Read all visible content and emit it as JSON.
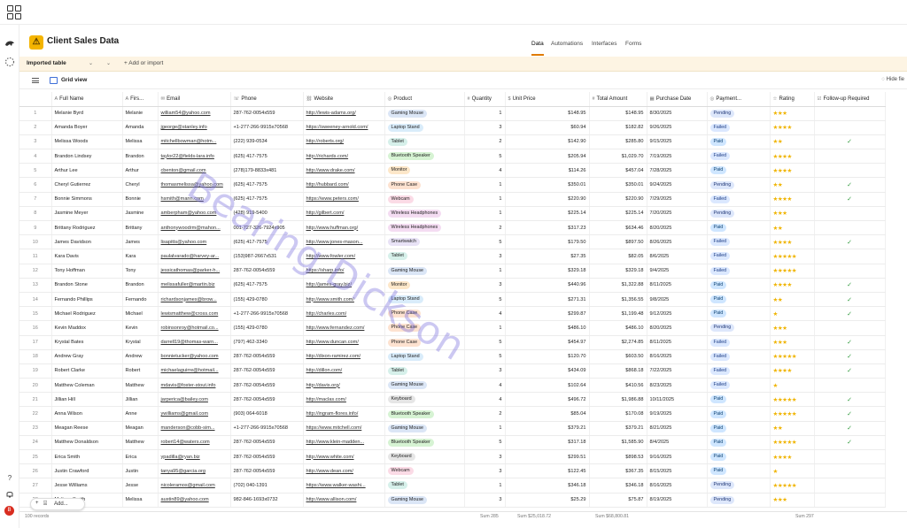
{
  "app": {
    "title": "Client Sales Data",
    "logo_color": "#f4b400"
  },
  "nav": {
    "tabs": [
      "Data",
      "Automations",
      "Interfaces",
      "Forms"
    ],
    "active": "Data"
  },
  "tablebar": {
    "table_name": "Imported table",
    "add_import": "Add or import"
  },
  "viewbar": {
    "view": "Grid view",
    "hide_fields": "Hide fie"
  },
  "columns": [
    "Full Name",
    "Firs...",
    "Email",
    "Phone",
    "Website",
    "Product",
    "Quantity",
    "Unit Price",
    "Total Amount",
    "Purchase Date",
    "Payment...",
    "Rating",
    "Follow-up Required"
  ],
  "rows": [
    [
      "1",
      "Melanie Byrd",
      "Melanie",
      "william54@yahoo.com",
      "287-762-0054x559",
      "http://lewis-adams.org/",
      "Gaming Mouse",
      "1",
      "$148.95",
      "$148.95",
      "8/30/2025",
      "Pending",
      "★★★",
      ""
    ],
    [
      "2",
      "Amanda Boyer",
      "Amanda",
      "jgeorge@stanley.info",
      "+1-277-266-9915x70568",
      "https://sweeney-arnold.com/",
      "Laptop Stand",
      "3",
      "$60.94",
      "$182.82",
      "9/26/2025",
      "Failed",
      "★★★★",
      ""
    ],
    [
      "3",
      "Melissa Woods",
      "Melissa",
      "mitchellbowman@hotm...",
      "(222) 939-0534",
      "http://roberts.org/",
      "Tablet",
      "2",
      "$142.90",
      "$285.80",
      "9/15/2025",
      "Paid",
      "★★",
      "✓"
    ],
    [
      "4",
      "Brandon Lindsey",
      "Brandon",
      "taylor22@fields-lara.info",
      "(625) 417-7575",
      "http://richards.com/",
      "Bluetooth Speaker",
      "5",
      "$205.94",
      "$1,029.70",
      "7/19/2025",
      "Failed",
      "★★★★",
      ""
    ],
    [
      "5",
      "Arthur Lee",
      "Arthur",
      "cbenton@gmail.com",
      "(278)179-8833x481",
      "http://www.drake.com/",
      "Monitor",
      "4",
      "$114.26",
      "$457.04",
      "7/28/2025",
      "Paid",
      "★★★★",
      ""
    ],
    [
      "6",
      "Cheryl Gutierrez",
      "Cheryl",
      "thomasmelissa@yahoo.com",
      "(625) 417-7575",
      "http://hubbard.com/",
      "Phone Case",
      "1",
      "$350.01",
      "$350.01",
      "9/24/2025",
      "Pending",
      "★★",
      "✓"
    ],
    [
      "7",
      "Bonnie Simmons",
      "Bonnie",
      "hsmith@mann.com",
      "(625) 417-7575",
      "https://www.peters.com/",
      "Webcam",
      "1",
      "$220.90",
      "$220.90",
      "7/29/2025",
      "Failed",
      "★★★★",
      "✓"
    ],
    [
      "8",
      "Jasmine Meyer",
      "Jasmine",
      "amberpham@yahoo.com",
      "(428) 919-5400",
      "http://gilbert.com/",
      "Wireless Headphones",
      "1",
      "$225.14",
      "$225.14",
      "7/20/2025",
      "Pending",
      "★★★",
      ""
    ],
    [
      "9",
      "Brittany Rodriguez",
      "Brittany",
      "anthonywoodrm@mahon...",
      "001-727-326-7924x905",
      "http://www.huffman.org/",
      "Wireless Headphones",
      "2",
      "$317.23",
      "$634.46",
      "8/20/2025",
      "Paid",
      "★★",
      ""
    ],
    [
      "10",
      "James Davidson",
      "James",
      "lisapitts@yahoo.com",
      "(625) 417-7575",
      "http://www.jones-mason...",
      "Smartwatch",
      "5",
      "$179.50",
      "$897.50",
      "8/26/2025",
      "Failed",
      "★★★★",
      "✓"
    ],
    [
      "11",
      "Kara Davis",
      "Kara",
      "paulalvarado@harvey-ar...",
      "(153)987-2667x531",
      "http://www.fowler.com/",
      "Tablet",
      "3",
      "$27.35",
      "$82.05",
      "8/6/2025",
      "Failed",
      "★★★★★",
      ""
    ],
    [
      "12",
      "Tony Hoffman",
      "Tony",
      "jessicathomas@parker-h...",
      "287-762-0054x559",
      "https://sharp.info/",
      "Gaming Mouse",
      "1",
      "$329.18",
      "$329.18",
      "9/4/2025",
      "Failed",
      "★★★★★",
      ""
    ],
    [
      "13",
      "Brandon Stone",
      "Brandon",
      "melissafuller@martin.biz",
      "(625) 417-7575",
      "http://james-gray.biz/",
      "Monitor",
      "3",
      "$440.96",
      "$1,322.88",
      "8/11/2025",
      "Paid",
      "★★★★",
      "✓"
    ],
    [
      "14",
      "Fernando Phillips",
      "Fernando",
      "richardsonjames@brow...",
      "(155) 429-0780",
      "http://www.smith.com/",
      "Laptop Stand",
      "5",
      "$271.31",
      "$1,356.55",
      "9/8/2025",
      "Paid",
      "★★",
      "✓"
    ],
    [
      "15",
      "Michael Rodriguez",
      "Michael",
      "lewismatthew@cross.com",
      "+1-277-266-9915x70568",
      "http://charles.com/",
      "Phone Case",
      "4",
      "$299.87",
      "$1,199.48",
      "9/12/2025",
      "Paid",
      "★",
      "✓"
    ],
    [
      "16",
      "Kevin Maddox",
      "Kevin",
      "robinsonroy@hotmail.co...",
      "(155) 429-0780",
      "http://www.fernandez.com/",
      "Phone Case",
      "1",
      "$486.10",
      "$486.10",
      "8/20/2025",
      "Pending",
      "★★★",
      ""
    ],
    [
      "17",
      "Krystal Bates",
      "Krystal",
      "darrell19@thomas-warn...",
      "(797) 462-3340",
      "http://www.duncan.com/",
      "Phone Case",
      "5",
      "$454.97",
      "$2,274.85",
      "8/11/2025",
      "Failed",
      "★★★",
      "✓"
    ],
    [
      "18",
      "Andrew Gray",
      "Andrew",
      "bonnietucker@yahoo.com",
      "287-762-0054x559",
      "http://dixon-ramirez.com/",
      "Laptop Stand",
      "5",
      "$120.70",
      "$603.50",
      "8/16/2025",
      "Failed",
      "★★★★★",
      "✓"
    ],
    [
      "19",
      "Robert Clarke",
      "Robert",
      "michaelaguirre@hotmail...",
      "287-762-0054x559",
      "http://dillon.com/",
      "Tablet",
      "3",
      "$434.09",
      "$868.18",
      "7/22/2025",
      "Failed",
      "★★★★",
      "✓"
    ],
    [
      "20",
      "Matthew Coleman",
      "Matthew",
      "mdavis@foster-stout.info",
      "287-762-0054x559",
      "http://davis.org/",
      "Gaming Mouse",
      "4",
      "$102.64",
      "$410.56",
      "8/23/2025",
      "Failed",
      "★",
      ""
    ],
    [
      "21",
      "Jillian Hill",
      "Jillian",
      "jarperica@bailey.com",
      "287-762-0054x559",
      "http://maclas.com/",
      "Keyboard",
      "4",
      "$496.72",
      "$1,986.88",
      "10/11/2025",
      "Paid",
      "★★★★★",
      "✓"
    ],
    [
      "22",
      "Anna Wilson",
      "Anne",
      "ywilliams@gmail.com",
      "(903) 064-6018",
      "http://ingram-flores.info/",
      "Bluetooth Speaker",
      "2",
      "$85.04",
      "$170.08",
      "9/19/2025",
      "Paid",
      "★★★★★",
      "✓"
    ],
    [
      "23",
      "Meagan Reese",
      "Meagan",
      "manderson@cobb-sim...",
      "+1-277-266-9915x70568",
      "https://www.mitchell.com/",
      "Gaming Mouse",
      "1",
      "$379.21",
      "$379.21",
      "8/21/2025",
      "Paid",
      "★★",
      "✓"
    ],
    [
      "24",
      "Matthew Donaldson",
      "Matthew",
      "robert14@waters.com",
      "287-762-0054x559",
      "http://www.klein-madden...",
      "Bluetooth Speaker",
      "5",
      "$317.18",
      "$1,585.90",
      "8/4/2025",
      "Paid",
      "★★★★★",
      "✓"
    ],
    [
      "25",
      "Erica Smith",
      "Erica",
      "ypadilla@ryan.biz",
      "287-762-0054x559",
      "http://www.white.com/",
      "Keyboard",
      "3",
      "$299.51",
      "$898.53",
      "9/16/2025",
      "Paid",
      "★★★★",
      ""
    ],
    [
      "26",
      "Justin Crawford",
      "Justin",
      "tanya95@garcia.org",
      "287-762-0054x559",
      "http://www.dean.com/",
      "Webcam",
      "3",
      "$122.45",
      "$367.35",
      "8/15/2025",
      "Paid",
      "★",
      ""
    ],
    [
      "27",
      "Jesse Williams",
      "Jesse",
      "nicoleramos@gmail.com",
      "(702) 040-1391",
      "https://www.walker-washi...",
      "Tablet",
      "1",
      "$346.18",
      "$346.18",
      "8/16/2025",
      "Pending",
      "★★★★★",
      ""
    ],
    [
      "28",
      "Melissa Smith",
      "Melissa",
      "austin89@yahoo.com",
      "982-846-1693x0732",
      "http://www.allison.com/",
      "Gaming Mouse",
      "3",
      "$25.29",
      "$75.87",
      "8/19/2025",
      "Pending",
      "★★★",
      ""
    ]
  ],
  "product_colors": {
    "Gaming Mouse": "#dbe6f6",
    "Laptop Stand": "#d9ecfa",
    "Tablet": "#d6f0ea",
    "Bluetooth Speaker": "#d6f3d3",
    "Monitor": "#fde7c9",
    "Phone Case": "#fde2d0",
    "Webcam": "#fbdbe6",
    "Wireless Headphones": "#f4dcf2",
    "Smartwatch": "#e8e2f6",
    "Keyboard": "#e6e6e6"
  },
  "footer": {
    "records": "100 records",
    "sum_qty": "Sum 285",
    "sum_price": "Sum $25,018.72",
    "sum_total": "Sum $68,800.81",
    "sum_rating": "Sum 297"
  },
  "add_button": "Add...",
  "watermark": "Bearing Dickson"
}
